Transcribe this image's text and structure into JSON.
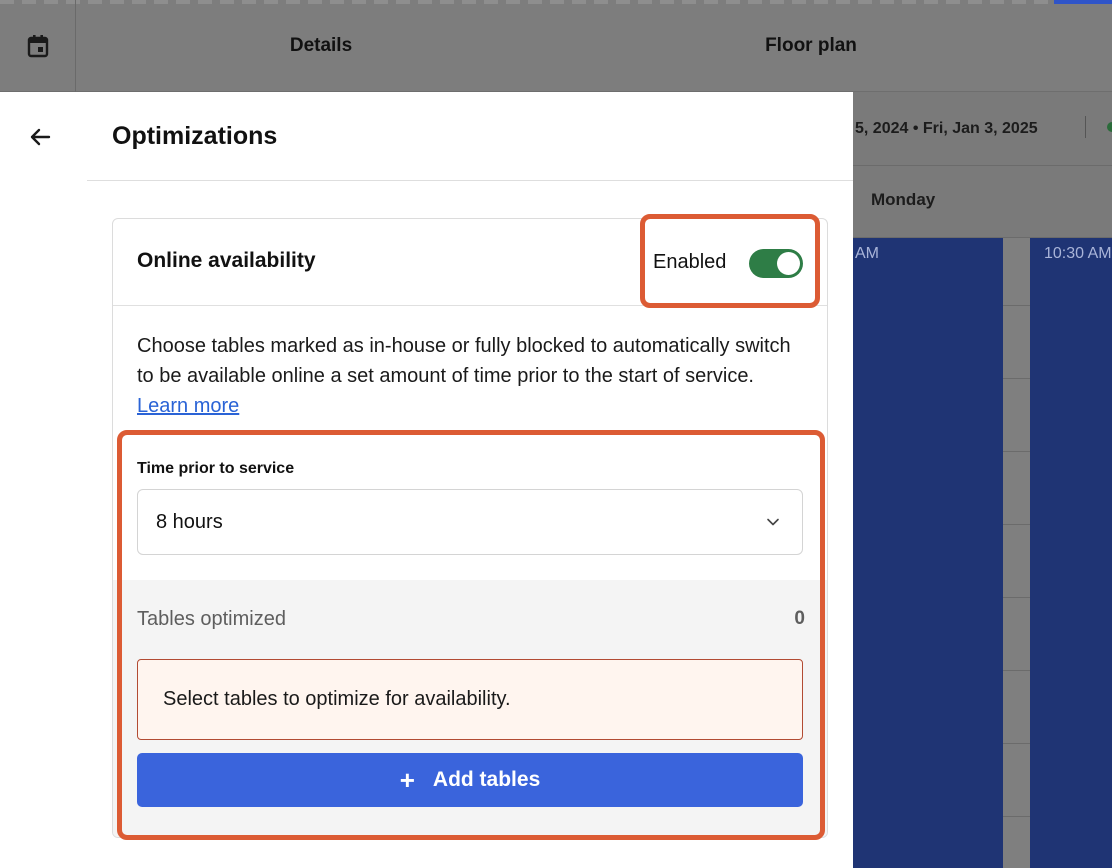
{
  "topbar": {
    "calendar_icon": "calendar-icon",
    "tabs": [
      {
        "label": "Details"
      },
      {
        "label": "Floor plan"
      }
    ]
  },
  "background": {
    "date_range": "5, 2024 • Fri, Jan 3, 2025",
    "day": "Monday",
    "times": [
      "AM",
      "10:30 AM"
    ]
  },
  "panel": {
    "back_icon": "arrow-left-icon",
    "title": "Optimizations",
    "card": {
      "title": "Online availability",
      "status_label": "Enabled",
      "toggle_on": true,
      "description": "Choose tables marked as in-house or fully blocked to automatically switch to be available online a set amount of time prior to the start of service.",
      "learn_more": "Learn more",
      "field_label": "Time prior to service",
      "field_value": "8 hours",
      "tables_label": "Tables optimized",
      "tables_count": "0",
      "alert_message": "Select tables to optimize for availability.",
      "add_button": "Add tables",
      "add_icon": "+"
    }
  },
  "colors": {
    "toggle_on": "#2e7d46",
    "primary_button": "#3a64dc",
    "alert_border": "#b24b33",
    "highlight": "#dc5b34",
    "link": "#2a63d6"
  }
}
